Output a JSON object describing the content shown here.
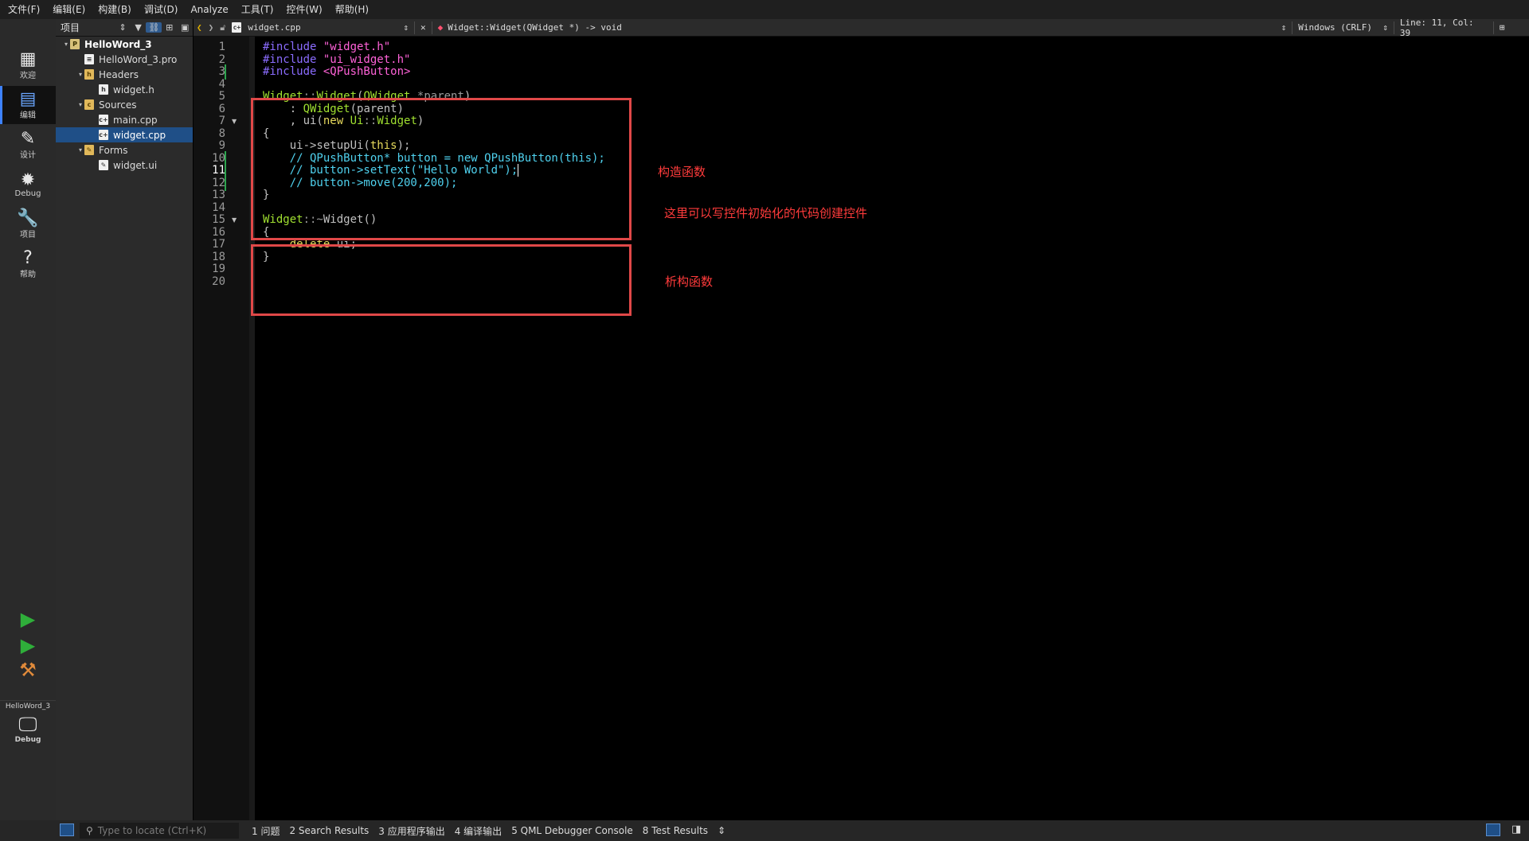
{
  "menu": [
    "文件(F)",
    "编辑(E)",
    "构建(B)",
    "调试(D)",
    "Analyze",
    "工具(T)",
    "控件(W)",
    "帮助(H)"
  ],
  "modes": [
    {
      "label": "欢迎",
      "glyph": "▦"
    },
    {
      "label": "编辑",
      "glyph": "▤"
    },
    {
      "label": "设计",
      "glyph": "✎"
    },
    {
      "label": "Debug",
      "glyph": "✹"
    },
    {
      "label": "项目",
      "glyph": "🔧"
    },
    {
      "label": "帮助",
      "glyph": "?"
    }
  ],
  "kit": {
    "project": "HelloWord_3",
    "config": "Debug"
  },
  "project_pane": {
    "selector": "项目"
  },
  "tree": [
    {
      "label": "HelloWord_3",
      "indent": 0,
      "arrow": "▾",
      "icon": "P",
      "kind": "proj",
      "bold": true
    },
    {
      "label": "HelloWord_3.pro",
      "indent": 1,
      "arrow": "",
      "icon": "≡",
      "kind": "file"
    },
    {
      "label": "Headers",
      "indent": 1,
      "arrow": "▾",
      "icon": "h",
      "kind": "folder"
    },
    {
      "label": "widget.h",
      "indent": 2,
      "arrow": "",
      "icon": "h",
      "kind": "file"
    },
    {
      "label": "Sources",
      "indent": 1,
      "arrow": "▾",
      "icon": "c",
      "kind": "folder"
    },
    {
      "label": "main.cpp",
      "indent": 2,
      "arrow": "",
      "icon": "c+",
      "kind": "file"
    },
    {
      "label": "widget.cpp",
      "indent": 2,
      "arrow": "",
      "icon": "c+",
      "kind": "file",
      "selected": true
    },
    {
      "label": "Forms",
      "indent": 1,
      "arrow": "▾",
      "icon": "✎",
      "kind": "folder"
    },
    {
      "label": "widget.ui",
      "indent": 2,
      "arrow": "",
      "icon": "✎",
      "kind": "file"
    }
  ],
  "editor": {
    "file_name": "widget.cpp",
    "function": "Widget::Widget(QWidget *) -> void",
    "line_ending": "Windows (CRLF)",
    "position": "Line: 11, Col: 39",
    "current_line": 11
  },
  "code": [
    [
      [
        "pp",
        "#include "
      ],
      [
        "str",
        "\"widget.h\""
      ]
    ],
    [
      [
        "pp",
        "#include "
      ],
      [
        "str",
        "\"ui_widget.h\""
      ]
    ],
    [
      [
        "pp",
        "#include "
      ],
      [
        "str",
        "<QPushButton>"
      ]
    ],
    [],
    [
      [
        "cls",
        "Widget"
      ],
      [
        "op",
        "::"
      ],
      [
        "cls",
        "Widget"
      ],
      [
        "fn",
        "("
      ],
      [
        "cls",
        "QWidget"
      ],
      [
        "fn",
        " "
      ],
      [
        "op",
        "*parent"
      ],
      [
        "fn",
        ")"
      ]
    ],
    [
      [
        "fn",
        "    : "
      ],
      [
        "cls",
        "QWidget"
      ],
      [
        "fn",
        "(parent)"
      ]
    ],
    [
      [
        "fn",
        "    , ui("
      ],
      [
        "kw",
        "new"
      ],
      [
        "fn",
        " "
      ],
      [
        "cls",
        "Ui"
      ],
      [
        "op",
        "::"
      ],
      [
        "cls",
        "Widget"
      ],
      [
        "fn",
        ")"
      ]
    ],
    [
      [
        "fn",
        "{"
      ]
    ],
    [
      [
        "fn",
        "    ui->setupUi("
      ],
      [
        "kw",
        "this"
      ],
      [
        "fn",
        ");"
      ]
    ],
    [
      [
        "cm",
        "    // QPushButton* button = new QPushButton(this);"
      ]
    ],
    [
      [
        "cm",
        "    // button->setText(\"Hello World\");"
      ]
    ],
    [
      [
        "cm",
        "    // button->move(200,200);"
      ]
    ],
    [
      [
        "fn",
        "}"
      ]
    ],
    [],
    [
      [
        "cls",
        "Widget"
      ],
      [
        "op",
        "::~"
      ],
      [
        "fn",
        "Widget()"
      ]
    ],
    [
      [
        "fn",
        "{"
      ]
    ],
    [
      [
        "kw",
        "    delete"
      ],
      [
        "fn",
        " ui;"
      ]
    ],
    [
      [
        "fn",
        "}"
      ]
    ],
    [],
    []
  ],
  "annotations": {
    "constructor": "构造函数",
    "init_hint": "这里可以写控件初始化的代码创建控件",
    "destructor": "析构函数"
  },
  "status": {
    "locator_placeholder": "Type to locate (Ctrl+K)",
    "panes": [
      "1 问题",
      "2 Search Results",
      "3 应用程序输出",
      "4 编译输出",
      "5 QML Debugger Console",
      "8 Test Results"
    ]
  }
}
